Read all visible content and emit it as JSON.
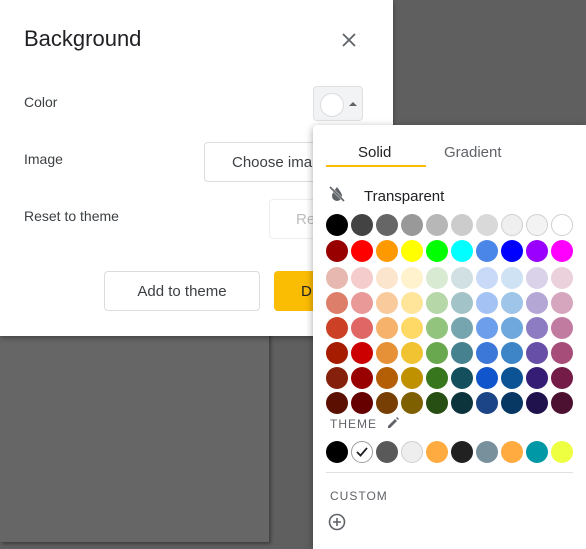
{
  "dialog": {
    "title": "Background",
    "color_label": "Color",
    "image_label": "Image",
    "reset_label": "Reset to theme",
    "choose_image_button": "Choose ima",
    "reset_button": "Re",
    "add_to_theme_button": "Add to theme",
    "done_button": "D"
  },
  "picker": {
    "tabs": [
      "Solid",
      "Gradient"
    ],
    "active_tab": "Solid",
    "transparent_label": "Transparent",
    "theme_label": "THEME",
    "custom_label": "CUSTOM",
    "rows": [
      [
        "#000000",
        "#434343",
        "#666666",
        "#999999",
        "#b7b7b7",
        "#cccccc",
        "#d9d9d9",
        "#efefef",
        "#f3f3f3",
        "#ffffff"
      ],
      [
        "#980000",
        "#ff0000",
        "#ff9900",
        "#ffff00",
        "#00ff00",
        "#00ffff",
        "#4a86e8",
        "#0000ff",
        "#9900ff",
        "#ff00ff"
      ],
      [
        "#e6b8af",
        "#f4cccc",
        "#fce5cd",
        "#fff2cc",
        "#d9ead3",
        "#d0e0e3",
        "#c9daf8",
        "#cfe2f3",
        "#d9d2e9",
        "#ead1dc"
      ],
      [
        "#dd7e6b",
        "#ea9999",
        "#f9cb9c",
        "#ffe599",
        "#b6d7a8",
        "#a2c4c9",
        "#a4c2f4",
        "#9fc5e8",
        "#b4a7d6",
        "#d5a6bd"
      ],
      [
        "#cc4125",
        "#e06666",
        "#f6b26b",
        "#ffd966",
        "#93c47d",
        "#76a5af",
        "#6d9eeb",
        "#6fa8dc",
        "#8e7cc3",
        "#c27ba0"
      ],
      [
        "#a61c00",
        "#cc0000",
        "#e69138",
        "#f1c232",
        "#6aa84f",
        "#45818e",
        "#3c78d8",
        "#3d85c6",
        "#674ea7",
        "#a64d79"
      ],
      [
        "#85200c",
        "#990000",
        "#b45f06",
        "#bf9000",
        "#38761d",
        "#134f5c",
        "#1155cc",
        "#0b5394",
        "#351c75",
        "#741b47"
      ],
      [
        "#5b0f00",
        "#660000",
        "#783f04",
        "#7f6000",
        "#274e13",
        "#0c343d",
        "#1c4587",
        "#073763",
        "#20124d",
        "#4c1130"
      ]
    ],
    "theme_colors": [
      "#000000",
      "#ffffff",
      "#595959",
      "#eeeeee",
      "#ffab40",
      "#212121",
      "#78909c",
      "#ffab40",
      "#0097a7",
      "#eeff41"
    ],
    "theme_selected_index": 1
  }
}
